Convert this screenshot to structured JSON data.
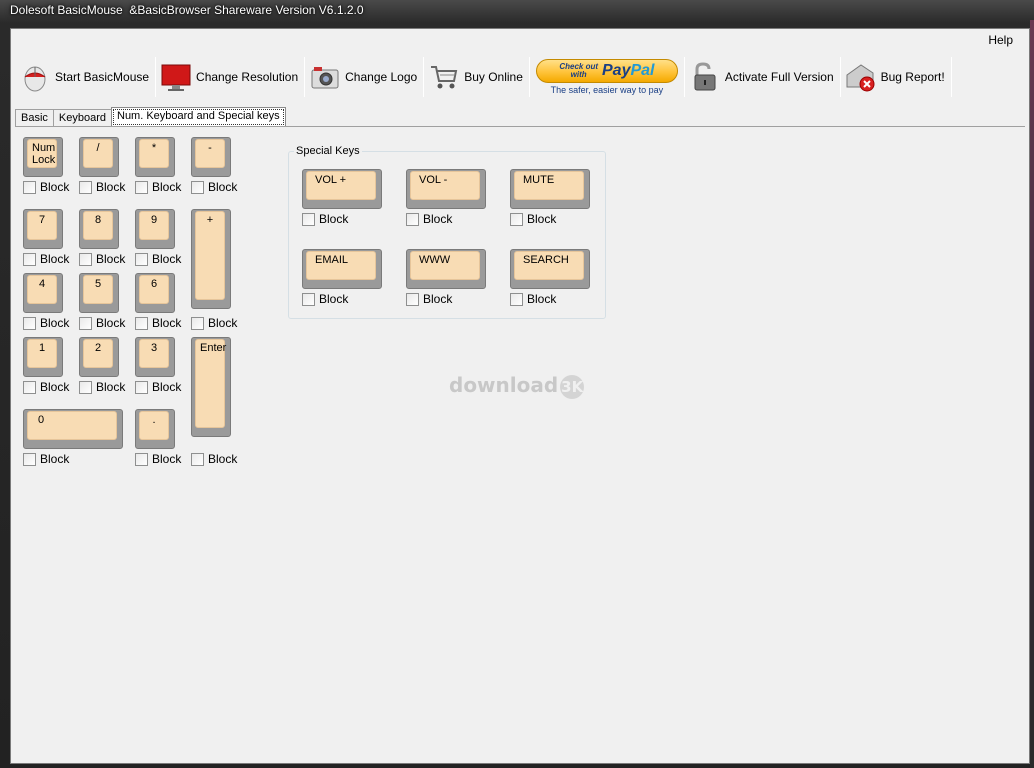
{
  "window": {
    "title": "Dolesoft BasicMouse  &BasicBrowser Shareware Version V6.1.2.0"
  },
  "menu": {
    "help": "Help"
  },
  "toolbar": {
    "start_basicmouse": "Start BasicMouse",
    "change_resolution": "Change Resolution",
    "change_logo": "Change Logo",
    "buy_online": "Buy Online",
    "paypal_check_out": "Check out",
    "paypal_with": "with",
    "paypal_brand_pay": "Pay",
    "paypal_brand_pal": "Pal",
    "paypal_tagline": "The safer, easier way to pay",
    "activate_full_version": "Activate Full Version",
    "bug_report": "Bug Report!"
  },
  "tabs": [
    "Basic",
    "Keyboard",
    "Num. Keyboard and Special keys"
  ],
  "numpad": {
    "numlock_line1": "Num",
    "numlock_line2": "Lock",
    "slash": "/",
    "star": "*",
    "minus": "-",
    "k7": "7",
    "k8": "8",
    "k9": "9",
    "plus": "+",
    "k4": "4",
    "k5": "5",
    "k6": "6",
    "k1": "1",
    "k2": "2",
    "k3": "3",
    "enter": "Enter",
    "k0": "0",
    "dot": ".",
    "block_label": "Block"
  },
  "special_keys": {
    "group_title": "Special Keys",
    "vol_up": "VOL +",
    "vol_down": "VOL -",
    "mute": "MUTE",
    "email": "EMAIL",
    "www": "WWW",
    "search": "SEARCH",
    "block_label": "Block"
  },
  "watermark": {
    "text": "download",
    "badge": "3K"
  },
  "colors": {
    "keycap": "#f8dcb4",
    "key_border": "#9a9a9a",
    "client_bg": "#f0f0f0"
  }
}
